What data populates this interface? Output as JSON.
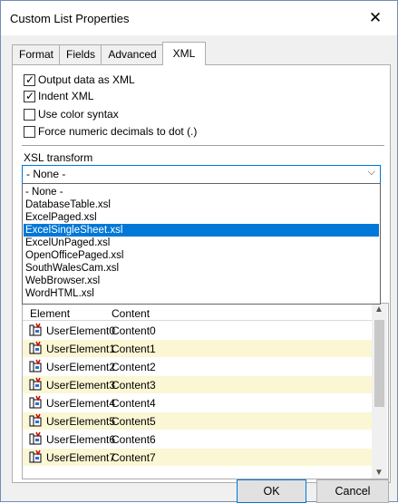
{
  "window": {
    "title": "Custom List Properties"
  },
  "tabs": [
    {
      "label": "Format"
    },
    {
      "label": "Fields"
    },
    {
      "label": "Advanced"
    },
    {
      "label": "XML"
    }
  ],
  "options": [
    {
      "label": "Output data as XML",
      "checked": true
    },
    {
      "label": "Indent XML",
      "checked": true
    },
    {
      "label": "Use color syntax",
      "checked": false
    },
    {
      "label": "Force numeric decimals to dot (.)",
      "checked": false
    }
  ],
  "xsl": {
    "label": "XSL transform",
    "selected": "- None -",
    "items": [
      "- None -",
      "DatabaseTable.xsl",
      "ExcelPaged.xsl",
      "ExcelSingleSheet.xsl",
      "ExcelUnPaged.xsl",
      "OpenOfficePaged.xsl",
      "SouthWalesCam.xsl",
      "WebBrowser.xsl",
      "WordHTML.xsl"
    ],
    "highlighted": "ExcelSingleSheet.xsl"
  },
  "grid": {
    "headers": {
      "element": "Element",
      "content": "Content"
    },
    "rows": [
      {
        "element": "UserElement0",
        "content": "Content0"
      },
      {
        "element": "UserElement1",
        "content": "Content1"
      },
      {
        "element": "UserElement2",
        "content": "Content2"
      },
      {
        "element": "UserElement3",
        "content": "Content3"
      },
      {
        "element": "UserElement4",
        "content": "Content4"
      },
      {
        "element": "UserElement5",
        "content": "Content5"
      },
      {
        "element": "UserElement6",
        "content": "Content6"
      },
      {
        "element": "UserElement7",
        "content": "Content7"
      }
    ]
  },
  "buttons": {
    "ok": "OK",
    "cancel": "Cancel"
  },
  "icons": {
    "close": "close-icon",
    "row": "xml-element-icon",
    "dropdown": "chevron-down-icon"
  },
  "colors": {
    "selection": "#0078d7",
    "alt_row": "#fbf7d4"
  }
}
